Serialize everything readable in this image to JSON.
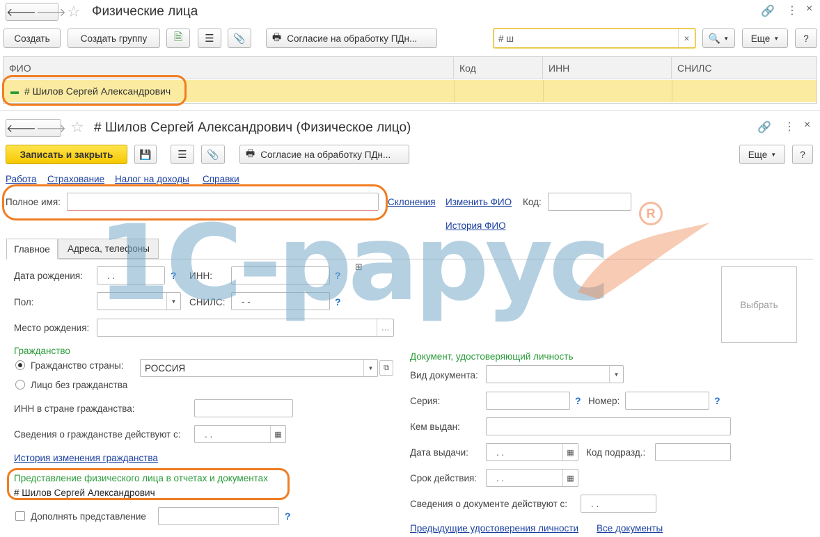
{
  "list_window": {
    "title": "Физические лица",
    "toolbar": {
      "create": "Создать",
      "create_group": "Создать группу",
      "consent": "Согласие на обработку ПДн...",
      "search_value": "# ш",
      "search_clear": "×",
      "more": "Еще",
      "help": "?"
    },
    "columns": [
      "ФИО",
      "Код",
      "ИНН",
      "СНИЛС"
    ],
    "rows": [
      {
        "fio": "# Шилов Сергей Александрович",
        "code": "",
        "inn": "",
        "snils": ""
      }
    ]
  },
  "form": {
    "title": "# Шилов Сергей Александрович (Физическое лицо)",
    "toolbar": {
      "save_close": "Записать и закрыть",
      "consent": "Согласие на обработку ПДн...",
      "more": "Еще",
      "help": "?"
    },
    "nav_links": [
      "Работа",
      "Страхование",
      "Налог на доходы",
      "Справки"
    ],
    "full_name_label": "Полное имя:",
    "full_name_value": "",
    "declensions_link": "Склонения",
    "change_fio_link": "Изменить ФИО",
    "code_label": "Код:",
    "fio_history_link": "История ФИО",
    "tabs": [
      "Главное",
      "Адреса, телефоны"
    ],
    "birth_date_label": "Дата рождения:",
    "birth_date_value": ". .",
    "inn_label": "ИНН:",
    "gender_label": "Пол:",
    "snils_label": "СНИЛС:",
    "snils_value": "- -",
    "birthplace_label": "Место рождения:",
    "photo_button": "Выбрать",
    "citizenship_header": "Гражданство",
    "citizenship_country_label": "Гражданство страны:",
    "citizenship_country_value": "РОССИЯ",
    "stateless_label": "Лицо без гражданства",
    "inn_citizenship_label": "ИНН в стране гражданства:",
    "citizenship_valid_label": "Сведения о гражданстве действуют с:",
    "citizenship_valid_value": ". .",
    "citizenship_history_link": "История изменения гражданства",
    "representation_header": "Представление физического лица в отчетах и документах",
    "representation_value": "# Шилов Сергей Александрович",
    "supplement_label": "Дополнять представление",
    "doc_header": "Документ, удостоверяющий личность",
    "doc_type_label": "Вид документа:",
    "series_label": "Серия:",
    "number_label": "Номер:",
    "issued_by_label": "Кем выдан:",
    "issue_date_label": "Дата выдачи:",
    "issue_date_value": ". .",
    "dept_code_label": "Код подразд.:",
    "validity_label": "Срок действия:",
    "validity_value": ". .",
    "doc_valid_label": "Сведения о документе действуют с:",
    "doc_valid_value": ". .",
    "prev_docs_link": "Предыдущие удостоверения личности",
    "all_docs_link": "Все документы",
    "question": "?"
  },
  "watermark": "1С-рарус",
  "colors": {
    "accent_yellow": "#f6c800",
    "selected_row": "#fbeba0",
    "link_blue": "#1a3fa0",
    "green_header": "#2a9a3a",
    "highlight_orange": "#f07d23"
  }
}
